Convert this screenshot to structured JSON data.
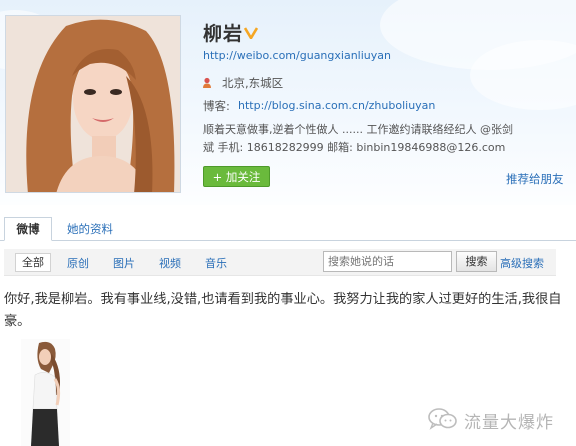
{
  "profile": {
    "name": "柳岩",
    "weibo_url": "http://weibo.com/guangxianliuyan",
    "location": "北京,东城区",
    "blog_label": "博客:",
    "blog_url": "http://blog.sina.com.cn/zhuboliuyan",
    "bio_line1": "顺着天意做事,逆着个性做人 ...... 工作邀约请联络经纪人 @张剑",
    "bio_line2": "斌 手机: 18618282999 邮箱: binbin19846988@126.com",
    "follow_label": "+ 加关注",
    "recommend_label": "推荐给朋友"
  },
  "tabs": [
    "微博",
    "她的资料"
  ],
  "filters": [
    "全部",
    "原创",
    "图片",
    "视频",
    "音乐"
  ],
  "search": {
    "placeholder": "搜索她说的话",
    "button": "搜索",
    "advanced": "高级搜索"
  },
  "post": {
    "text": "你好,我是柳岩。我有事业线,没错,也请看到我的事业心。我努力让我的家人过更好的生活,我很自豪。"
  },
  "watermark": {
    "text": "流量大爆炸",
    "icon": "wechat-icon"
  },
  "colors": {
    "link": "#2a6fb8",
    "follow_button": "#6aba3c",
    "verified_badge": "#f5a623"
  }
}
